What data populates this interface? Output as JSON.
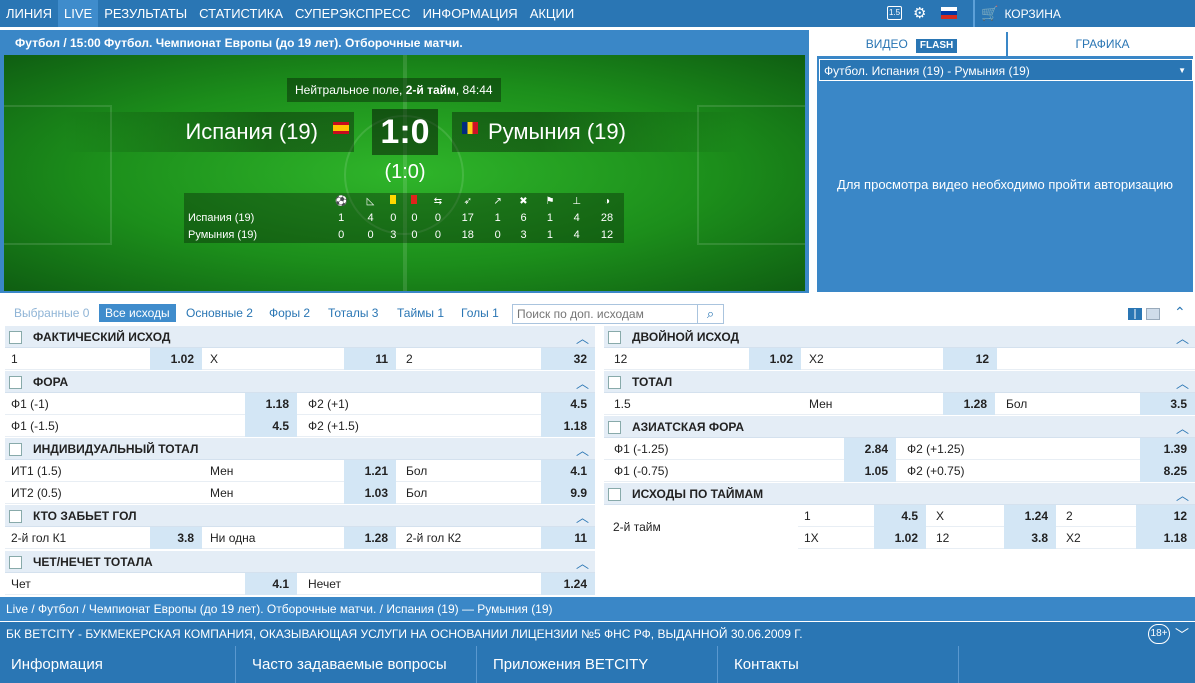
{
  "topnav": {
    "items": [
      "ЛИНИЯ",
      "LIVE",
      "РЕЗУЛЬТАТЫ",
      "СТАТИСТИКА",
      "СУПЕРЭКСПРЕСС",
      "ИНФОРМАЦИЯ",
      "АКЦИИ"
    ],
    "active": "LIVE",
    "odds_format_badge": "1.5",
    "cart_label": "КОРЗИНА"
  },
  "match": {
    "breadcrumb": "Футбол  /  15:00 Футбол. Чемпионат Европы (до 19 лет). Отборочные матчи.",
    "status_prefix": "Нейтральное поле, ",
    "status_half": "2-й тайм",
    "status_time": ", 84:44",
    "team1": "Испания (19)",
    "team2": "Румыния (19)",
    "score": "1:0",
    "half_score": "(1:0)",
    "stat_icons": [
      "ball-icon",
      "corner-icon",
      "yellow-card-icon",
      "red-card-icon",
      "substitution-icon",
      "shots-icon",
      "shots-on-target-icon",
      "fouls-icon",
      "offside-icon",
      "goal-kick-icon",
      "throw-in-icon",
      "possession-icon"
    ],
    "stats": [
      {
        "team": "Испания (19)",
        "values": [
          "1",
          "4",
          "0",
          "0",
          "0",
          "17",
          "1",
          "6",
          "1",
          "4",
          "28"
        ]
      },
      {
        "team": "Румыния (19)",
        "values": [
          "0",
          "0",
          "3",
          "0",
          "0",
          "18",
          "0",
          "3",
          "1",
          "4",
          "12"
        ]
      }
    ]
  },
  "video": {
    "tab_video": "ВИДЕО",
    "tab_flash": "FLASH",
    "tab_graphics": "ГРАФИКА",
    "selected_match": "Футбол. Испания (19) - Румыния (19)",
    "message": "Для просмотра видео необходимо пройти авторизацию"
  },
  "filters": {
    "tabs": [
      "Выбранные 0",
      "Все исходы",
      "Основные 2",
      "Форы 2",
      "Тоталы 3",
      "Таймы 1",
      "Голы 1"
    ],
    "active": "Все исходы",
    "search_placeholder": "Поиск по доп. исходам"
  },
  "markets_left": [
    {
      "title": "ФАКТИЧЕСКИЙ ИСХОД",
      "rows": [
        [
          "1",
          "1.02",
          "X",
          "11",
          "2",
          "32"
        ]
      ]
    },
    {
      "title": "ФОРА",
      "rows": [
        [
          "Ф1 (-1)",
          "1.18",
          "Ф2 (+1)",
          "4.5"
        ],
        [
          "Ф1 (-1.5)",
          "4.5",
          "Ф2 (+1.5)",
          "1.18"
        ]
      ]
    },
    {
      "title": "ИНДИВИДУАЛЬНЫЙ ТОТАЛ",
      "rows": [
        [
          "ИТ1 (1.5)",
          "Мен",
          "1.21",
          "Бол",
          "4.1"
        ],
        [
          "ИТ2 (0.5)",
          "Мен",
          "1.03",
          "Бол",
          "9.9"
        ]
      ]
    },
    {
      "title": "КТО ЗАБЬЕТ ГОЛ",
      "rows": [
        [
          "2-й гол К1",
          "3.8",
          "Ни одна",
          "1.28",
          "2-й гол К2",
          "11"
        ]
      ]
    },
    {
      "title": "ЧЕТ/НЕЧЕТ ТОТАЛА",
      "rows": [
        [
          "Чет",
          "4.1",
          "Нечет",
          "1.24"
        ]
      ]
    }
  ],
  "markets_right": [
    {
      "title": "ДВОЙНОЙ ИСХОД",
      "rows": [
        [
          "12",
          "1.02",
          "X2",
          "12"
        ]
      ]
    },
    {
      "title": "ТОТАЛ",
      "rows": [
        [
          "1.5",
          "Мен",
          "1.28",
          "Бол",
          "3.5"
        ]
      ]
    },
    {
      "title": "АЗИАТСКАЯ ФОРА",
      "rows": [
        [
          "Ф1 (-1.25)",
          "2.84",
          "Ф2 (+1.25)",
          "1.39"
        ],
        [
          "Ф1 (-0.75)",
          "1.05",
          "Ф2 (+0.75)",
          "8.25"
        ]
      ]
    },
    {
      "title": "ИСХОДЫ ПО ТАЙМАМ",
      "period": "2-й тайм",
      "rows": [
        [
          "1",
          "4.5",
          "X",
          "1.24",
          "2",
          "12"
        ],
        [
          "1X",
          "1.02",
          "12",
          "3.8",
          "X2",
          "1.18"
        ]
      ]
    }
  ],
  "bottom": {
    "breadcrumb": "Live / Футбол / Чемпионат Европы (до 19 лет). Отборочные матчи. / Испания (19) — Румыния (19)",
    "license": "БК BETCITY - БУКМЕКЕРСКАЯ КОМПАНИЯ, ОКАЗЫВАЮЩАЯ УСЛУГИ НА ОСНОВАНИИ ЛИЦЕНЗИИ №5 ФНС РФ, ВЫДАННОЙ 30.06.2009 Г.",
    "age": "18+",
    "footer_links": [
      "Информация",
      "Часто задаваемые вопросы",
      "Приложения BETCITY",
      "Контакты"
    ]
  }
}
